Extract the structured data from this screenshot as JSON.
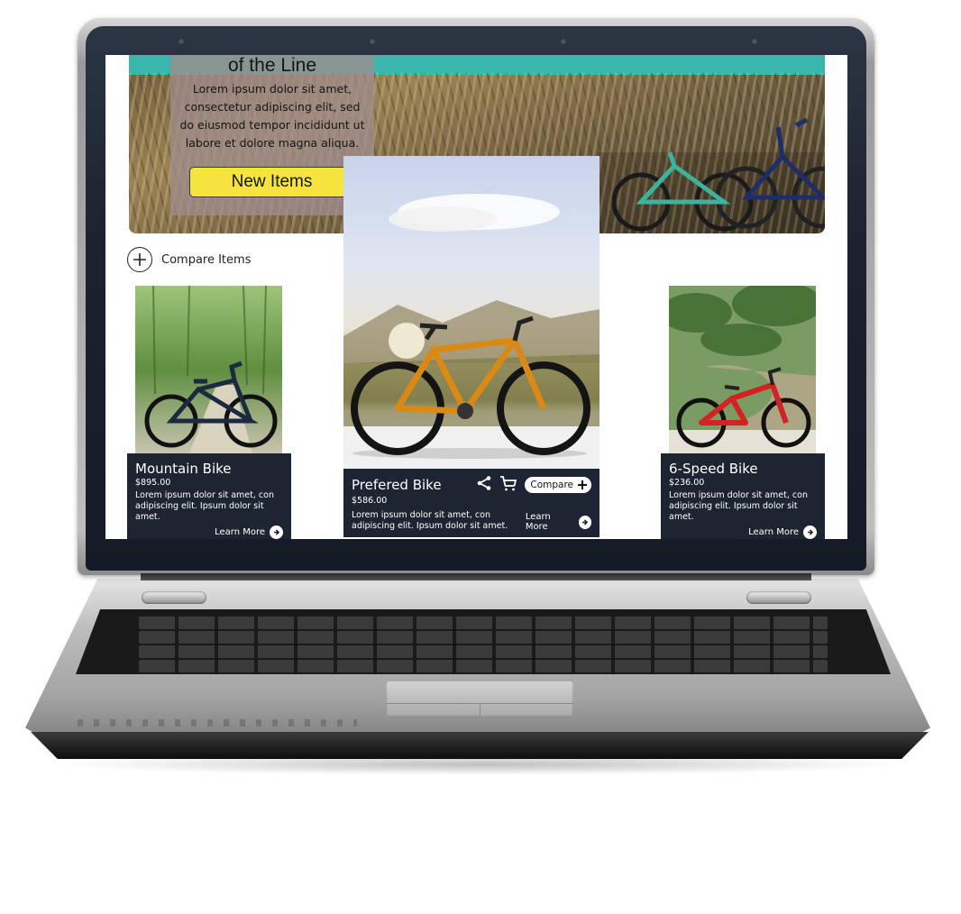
{
  "hero": {
    "title": "of the Line",
    "text": "Lorem ipsum dolor sit amet, consectetur adipiscing elit, sed do eiusmod tempor incididunt ut labore et dolore magna aliqua.",
    "button_label": "New Items",
    "button_color": "#f4e43d"
  },
  "compare_bar": {
    "label": "Compare Items",
    "icon": "plus-circle-icon"
  },
  "products": {
    "left": {
      "title": "Mountain Bike",
      "price": "$895.00",
      "description": "Lorem ipsum dolor sit amet, con adipiscing elit. Ipsum dolor sit amet.",
      "learn_more": "Learn More"
    },
    "featured": {
      "title": "Prefered Bike",
      "price": "$586.00",
      "description": "Lorem ipsum dolor sit amet, con adipiscing elit. Ipsum dolor sit amet.",
      "learn_more": "Learn More",
      "compare_label": "Compare",
      "icons": [
        "share-icon",
        "cart-icon",
        "plus-icon"
      ]
    },
    "right": {
      "title": "6-Speed Bike",
      "price": "$236.00",
      "description": "Lorem ipsum dolor sit amet, con adipiscing elit. Ipsum dolor sit amet.",
      "learn_more": "Learn More"
    }
  },
  "colors": {
    "card_background": "#1f2433",
    "accent_yellow": "#f4e43d",
    "bezel": "#1b2230"
  }
}
